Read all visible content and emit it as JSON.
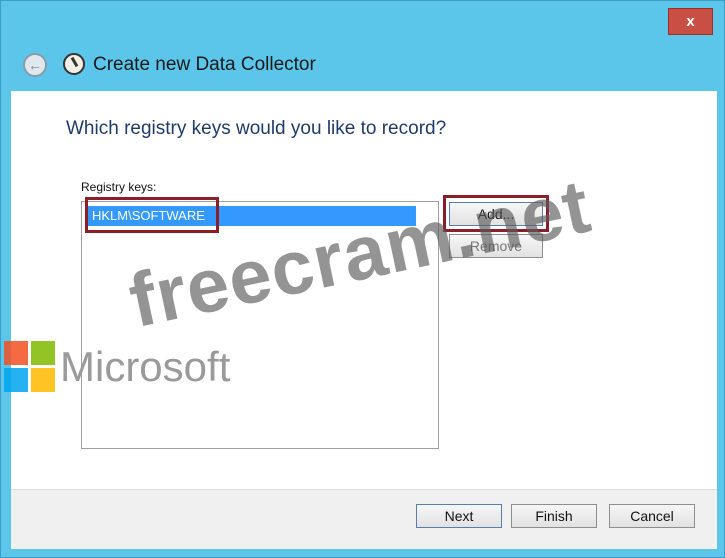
{
  "window": {
    "title": "Create new Data Collector",
    "close_label": "x"
  },
  "main": {
    "question": "Which registry keys would you like to record?",
    "registry_label": "Registry keys:",
    "registry_items": [
      "HKLM\\SOFTWARE"
    ],
    "add_label": "Add...",
    "remove_label": "Remove"
  },
  "footer": {
    "next_label": "Next",
    "finish_label": "Finish",
    "cancel_label": "Cancel"
  },
  "overlay": {
    "watermark": "freecram.net",
    "brand": "Microsoft"
  },
  "colors": {
    "titlebar": "#5bc5ea",
    "close": "#c94f45",
    "selection": "#3399ff",
    "highlight_box": "#8a1f2a",
    "ms_red": "#f25022",
    "ms_green": "#7fba00",
    "ms_blue": "#00a4ef",
    "ms_yellow": "#ffb900"
  },
  "icons": {
    "back": "back-arrow-icon",
    "app": "data-collector-icon",
    "close": "close-icon"
  }
}
